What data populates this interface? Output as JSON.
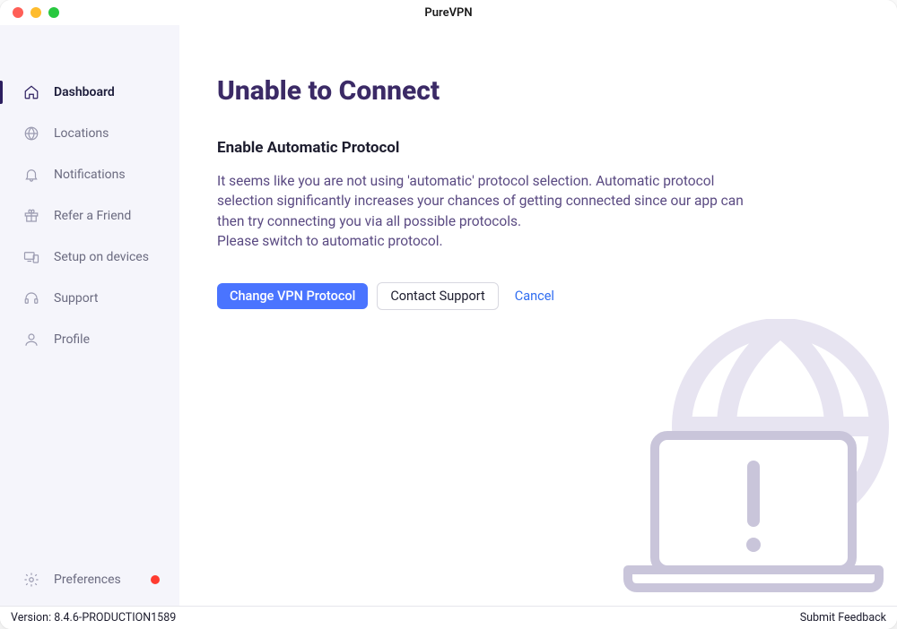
{
  "window": {
    "title": "PureVPN"
  },
  "sidebar": {
    "items": [
      {
        "label": "Dashboard",
        "icon": "home",
        "active": true
      },
      {
        "label": "Locations",
        "icon": "globe",
        "active": false
      },
      {
        "label": "Notifications",
        "icon": "bell",
        "active": false
      },
      {
        "label": "Refer a Friend",
        "icon": "gift",
        "active": false
      },
      {
        "label": "Setup on devices",
        "icon": "devices",
        "active": false
      },
      {
        "label": "Support",
        "icon": "headset",
        "active": false
      },
      {
        "label": "Profile",
        "icon": "user",
        "active": false
      }
    ],
    "preferences_label": "Preferences",
    "preferences_has_badge": true
  },
  "main": {
    "heading": "Unable to Connect",
    "subheading": "Enable Automatic Protocol",
    "body": "It seems like you are not using 'automatic' protocol selection. Automatic protocol selection significantly increases your chances of getting connected since our app can then try connecting you via all possible protocols.\nPlease switch to automatic protocol.",
    "actions": {
      "primary": "Change VPN Protocol",
      "secondary": "Contact Support",
      "cancel": "Cancel"
    }
  },
  "statusbar": {
    "version": "Version: 8.4.6-PRODUCTION1589",
    "feedback": "Submit Feedback"
  }
}
